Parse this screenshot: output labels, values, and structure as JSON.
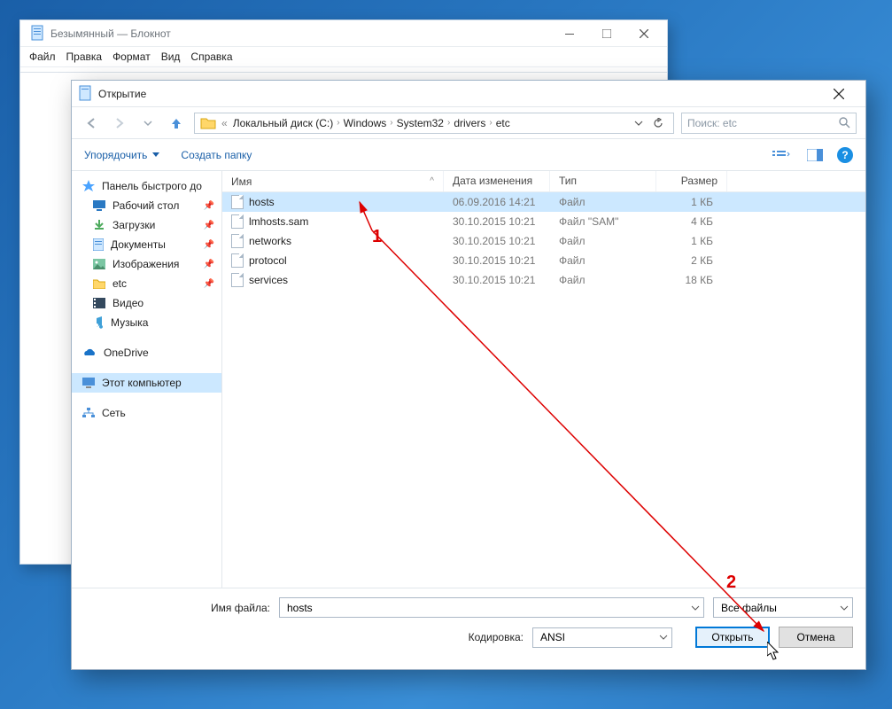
{
  "notepad": {
    "title": "Безымянный — Блокнот",
    "menu": [
      "Файл",
      "Правка",
      "Формат",
      "Вид",
      "Справка"
    ]
  },
  "dialog": {
    "title": "Открытие",
    "breadcrumb": [
      "Локальный диск (C:)",
      "Windows",
      "System32",
      "drivers",
      "etc"
    ],
    "search_placeholder": "Поиск: etc",
    "toolbar": {
      "organize": "Упорядочить",
      "newfolder": "Создать папку"
    },
    "sidebar": {
      "quick_access": "Панель быстрого до",
      "items_pinned": [
        {
          "label": "Рабочий стол",
          "icon": "desktop"
        },
        {
          "label": "Загрузки",
          "icon": "downloads"
        },
        {
          "label": "Документы",
          "icon": "documents"
        },
        {
          "label": "Изображения",
          "icon": "pictures"
        },
        {
          "label": "etc",
          "icon": "folder"
        }
      ],
      "items_plain": [
        {
          "label": "Видео",
          "icon": "video"
        },
        {
          "label": "Музыка",
          "icon": "music"
        }
      ],
      "onedrive": "OneDrive",
      "thispc": "Этот компьютер",
      "network": "Сеть"
    },
    "columns": {
      "name": "Имя",
      "date": "Дата изменения",
      "type": "Тип",
      "size": "Размер"
    },
    "files": [
      {
        "name": "hosts",
        "date": "06.09.2016 14:21",
        "type": "Файл",
        "size": "1 КБ",
        "selected": true
      },
      {
        "name": "lmhosts.sam",
        "date": "30.10.2015 10:21",
        "type": "Файл \"SAM\"",
        "size": "4 КБ",
        "selected": false
      },
      {
        "name": "networks",
        "date": "30.10.2015 10:21",
        "type": "Файл",
        "size": "1 КБ",
        "selected": false
      },
      {
        "name": "protocol",
        "date": "30.10.2015 10:21",
        "type": "Файл",
        "size": "2 КБ",
        "selected": false
      },
      {
        "name": "services",
        "date": "30.10.2015 10:21",
        "type": "Файл",
        "size": "18 КБ",
        "selected": false
      }
    ],
    "bottom": {
      "filename_label": "Имя файла:",
      "filename_value": "hosts",
      "filter_value": "Все файлы",
      "encoding_label": "Кодировка:",
      "encoding_value": "ANSI",
      "open": "Открыть",
      "cancel": "Отмена"
    }
  },
  "annotations": {
    "one": "1",
    "two": "2"
  }
}
